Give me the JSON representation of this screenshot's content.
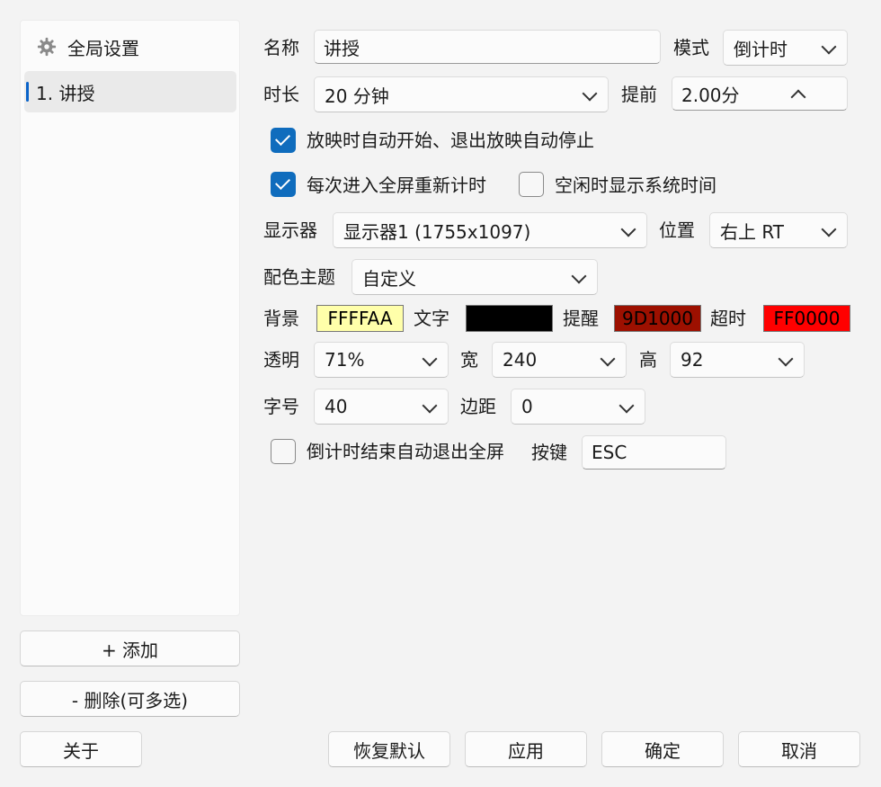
{
  "sidebar": {
    "global_label": "全局设置",
    "items": [
      {
        "label": "1. 讲授"
      }
    ],
    "add_label": "+  添加",
    "delete_label": "-  删除(可多选)",
    "about_label": "关于"
  },
  "form": {
    "name_label": "名称",
    "name_value": "讲授",
    "mode_label": "模式",
    "mode_value": "倒计时",
    "duration_label": "时长",
    "duration_value": "20 分钟",
    "advance_label": "提前",
    "advance_value": "2.00分",
    "auto_start_label": "放映时自动开始、退出放映自动停止",
    "auto_start_checked": true,
    "reset_fullscreen_label": "每次进入全屏重新计时",
    "reset_fullscreen_checked": true,
    "idle_time_label": "空闲时显示系统时间",
    "idle_time_checked": false,
    "display_label": "显示器",
    "display_value": "显示器1 (1755x1097)",
    "position_label": "位置",
    "position_value": "右上 RT",
    "theme_label": "配色主题",
    "theme_value": "自定义",
    "bg_label": "背景",
    "bg_value": "FFFFAA",
    "bg_color": "#FFFFAA",
    "text_label": "文字",
    "text_value": "",
    "text_color": "#000000",
    "remind_label": "提醒",
    "remind_value": "9D1000",
    "remind_color": "#9D1000",
    "overtime_label": "超时",
    "overtime_value": "FF0000",
    "overtime_color": "#FF0000",
    "opacity_label": "透明",
    "opacity_value": "71%",
    "width_label": "宽",
    "width_value": "240",
    "height_label": "高",
    "height_value": "92",
    "fontsize_label": "字号",
    "fontsize_value": "40",
    "margin_label": "边距",
    "margin_value": "0",
    "auto_exit_label": "倒计时结束自动退出全屏",
    "auto_exit_checked": false,
    "hotkey_label": "按键",
    "hotkey_value": "ESC"
  },
  "footer": {
    "restore_label": "恢复默认",
    "apply_label": "应用",
    "ok_label": "确定",
    "cancel_label": "取消"
  },
  "colors": {
    "accent": "#0F6CBD",
    "window_bg": "#F3F3F3"
  }
}
